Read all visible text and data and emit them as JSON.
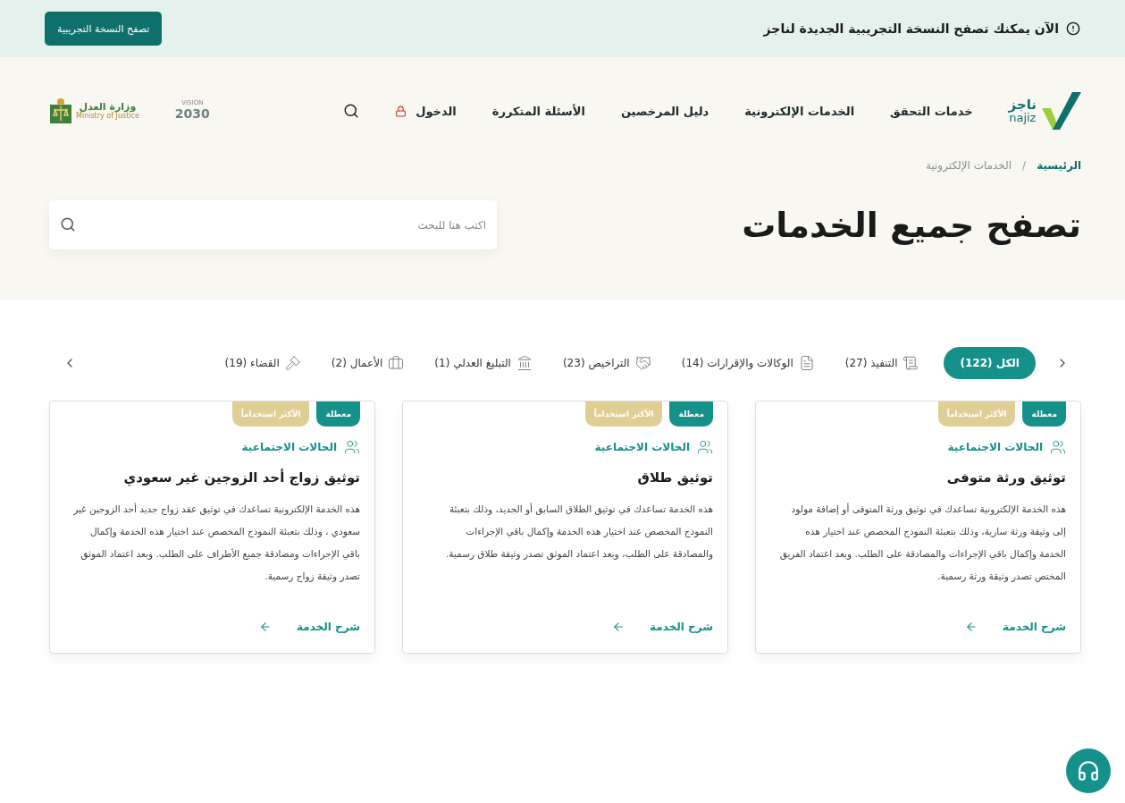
{
  "announcement": {
    "text": "الآن يمكنك تصفح النسخة التجريبية الجديدة لناجز",
    "button": "تصفح النسخة التجريبية"
  },
  "header": {
    "logo": {
      "arabic": "ناجز",
      "latin": "najiz"
    },
    "nav": [
      "خدمات التحقق",
      "الخدمات الإلكترونية",
      "دليل المرخصين",
      "الأسئلة المتكررة"
    ],
    "login": "الدخول",
    "vision_logo": {
      "top": "VISION",
      "year": "2030"
    },
    "ministry_logo": {
      "arabic": "وزارة العدل",
      "latin": "Ministry of Justice"
    }
  },
  "breadcrumb": {
    "items": [
      {
        "label": "الرئيسية",
        "current": false
      },
      {
        "label": "الخدمات الإلكترونية",
        "current": true
      }
    ],
    "separator": "/"
  },
  "page_title": "تصفح جميع الخدمات",
  "search": {
    "placeholder": "اكتب هنا للبحث"
  },
  "tabs": [
    {
      "label": "الكل (122)",
      "selected": true
    },
    {
      "label": "التنفيذ (27)",
      "selected": false
    },
    {
      "label": "الوكالات والإقرارات (14)",
      "selected": false
    },
    {
      "label": "التراخيص (23)",
      "selected": false
    },
    {
      "label": "التبليغ العدلي (1)",
      "selected": false
    },
    {
      "label": "الأعمال (2)",
      "selected": false
    },
    {
      "label": "القضاء (19)",
      "selected": false
    }
  ],
  "cards": [
    {
      "tags": [
        {
          "label": "معطلة",
          "kind": "status"
        },
        {
          "label": "الأكثر استخداماً",
          "kind": "popular"
        }
      ],
      "category": "الحالات الاجتماعية",
      "title": "توثيق ورثة متوفى",
      "description": "هذه الخدمة الإلكترونية تساعدك في توثيق ورثة المتوفى أو إضافة مولود إلى وثيقة ورثة سارية، وذلك بتعبئة النموذج المخصص عند اختيار هذه الخدمة وإكمال باقي الإجراءات والمصادقة على الطلب. وبعد اعتماد الفريق المختص تصدر وثيقة ورثة رسمية.",
      "link": "شرح الخدمة"
    },
    {
      "tags": [
        {
          "label": "معطلة",
          "kind": "status"
        },
        {
          "label": "الأكثر استخداماً",
          "kind": "popular"
        }
      ],
      "category": "الحالات الاجتماعية",
      "title": "توثيق طلاق",
      "description": "هذه الخدمة تساعدك في توثيق الطلاق السابق أو الجديد، وذلك بتعبئة النموذج المخصص عند اختيار هذه الخدمة وإكمال باقي الإجراءات والمصادقة على الطلب، وبعد اعتماد الموثق تصدر وثيقة طلاق رسمية.",
      "link": "شرح الخدمة"
    },
    {
      "tags": [
        {
          "label": "معطلة",
          "kind": "status"
        },
        {
          "label": "الأكثر استخداماً",
          "kind": "popular"
        }
      ],
      "category": "الحالات الاجتماعية",
      "title": "توثيق زواج أحد الزوجين غير سعودي",
      "description": "هذه الخدمة الإلكترونية تساعدك في توثيق عقد زواج جديد أحد الزوجين غير سعودي ، وذلك بتعبئة النموذج المخصص عند اختيار هذه الخدمة وإكمال باقي الإجراءات ومصادقة جميع الأطراف على الطلب. وبعد اعتماد الموثق تصدر وثيقة زواج رسمية.",
      "link": "شرح الخدمة"
    }
  ]
}
